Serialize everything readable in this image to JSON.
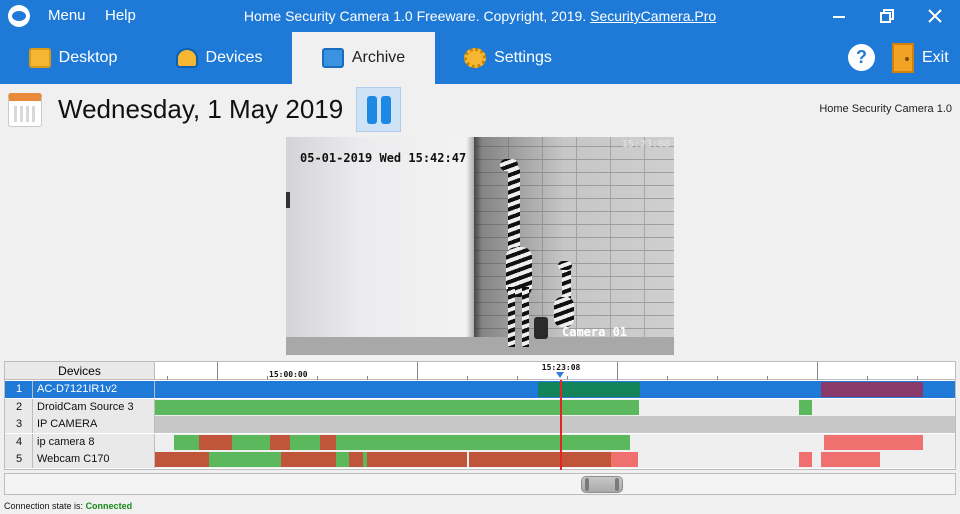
{
  "window": {
    "title_prefix": "Home Security Camera 1.0 Freeware. Copyright, 2019.",
    "title_link": "SecurityCamera.Pro",
    "menu": [
      "Menu",
      "Help"
    ]
  },
  "tabs": [
    {
      "label": "Desktop",
      "icon": "desktop-icon",
      "active": false
    },
    {
      "label": "Devices",
      "icon": "devices-icon",
      "active": false
    },
    {
      "label": "Archive",
      "icon": "archive-icon",
      "active": true
    },
    {
      "label": "Settings",
      "icon": "gear-icon",
      "active": false
    }
  ],
  "toolbar": {
    "help_label": "?",
    "exit_label": "Exit"
  },
  "header": {
    "date": "Wednesday, 1 May 2019",
    "version": "Home Security Camera 1.0"
  },
  "video": {
    "timestamp": "05-01-2019 Wed 15:42:47",
    "overlay_time": "15:23:08",
    "camera_label": "Camera 01"
  },
  "timeline": {
    "devices_header": "Devices",
    "ruler_label": "15:00:00",
    "cursor_time": "15:23:08",
    "cursor_fraction": 0.506,
    "colors": {
      "motion": "#5cb85c",
      "alarm": "#c0553a",
      "selected_motion": "#13835c",
      "selected_alarm": "#8a3a6a",
      "alert": "#f07070"
    },
    "rows": [
      {
        "num": "1",
        "name": "AC-D7121IR1v2",
        "selected": true,
        "disabled": false,
        "segments": [
          [
            0.479,
            0.606,
            "selected_motion"
          ],
          [
            0.833,
            0.96,
            "selected_alarm"
          ]
        ]
      },
      {
        "num": "2",
        "name": "DroidCam Source 3",
        "selected": false,
        "disabled": false,
        "segments": [
          [
            0.0,
            0.605,
            "motion"
          ],
          [
            0.805,
            0.821,
            "motion"
          ]
        ]
      },
      {
        "num": "3",
        "name": "IP CAMERA",
        "selected": false,
        "disabled": true,
        "segments": []
      },
      {
        "num": "4",
        "name": "ip camera 8",
        "selected": false,
        "disabled": false,
        "segments": [
          [
            0.024,
            0.055,
            "motion"
          ],
          [
            0.055,
            0.096,
            "alarm"
          ],
          [
            0.096,
            0.144,
            "motion"
          ],
          [
            0.144,
            0.169,
            "alarm"
          ],
          [
            0.169,
            0.206,
            "motion"
          ],
          [
            0.206,
            0.226,
            "alarm"
          ],
          [
            0.226,
            0.594,
            "motion"
          ],
          [
            0.836,
            0.884,
            "alert"
          ],
          [
            0.884,
            0.96,
            "alert"
          ]
        ]
      },
      {
        "num": "5",
        "name": "Webcam C170",
        "selected": false,
        "disabled": false,
        "segments": [
          [
            0.0,
            0.068,
            "alarm"
          ],
          [
            0.068,
            0.158,
            "motion"
          ],
          [
            0.158,
            0.226,
            "alarm"
          ],
          [
            0.226,
            0.243,
            "motion"
          ],
          [
            0.243,
            0.26,
            "alarm"
          ],
          [
            0.26,
            0.265,
            "motion"
          ],
          [
            0.265,
            0.39,
            "alarm"
          ],
          [
            0.393,
            0.57,
            "alarm"
          ],
          [
            0.57,
            0.604,
            "alert"
          ],
          [
            0.805,
            0.821,
            "alert"
          ],
          [
            0.833,
            0.906,
            "alert"
          ]
        ]
      }
    ]
  },
  "status": {
    "label": "Connection state is:",
    "value": "Connected"
  }
}
